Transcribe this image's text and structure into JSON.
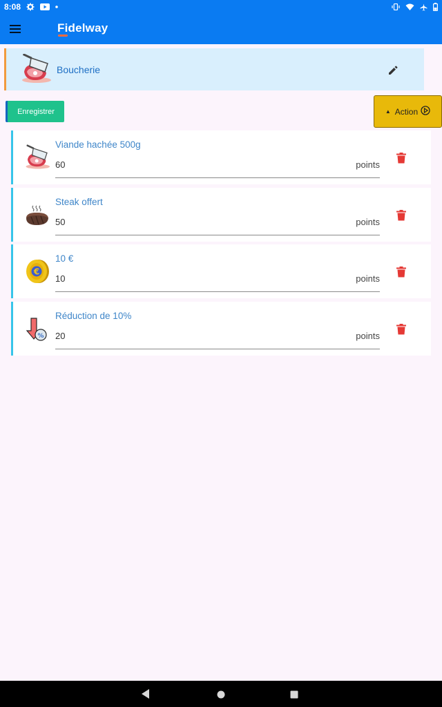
{
  "status_bar": {
    "time": "8:08",
    "left_icons": [
      "settings-icon",
      "youtube-icon",
      "dot-icon"
    ],
    "right_icons": [
      "vibrate-icon",
      "wifi-icon",
      "airplane-icon",
      "battery-icon"
    ]
  },
  "app_bar": {
    "title": "Fidelway",
    "menu_icon": "hamburger-menu-icon",
    "accent_color": "#ff6a3c"
  },
  "category": {
    "name": "Boucherie",
    "icon": "butcher-cleaver-meat-icon",
    "edit_icon": "pencil-icon"
  },
  "toolbar": {
    "save_label": "Enregistrer",
    "action_label": "Action",
    "action_icon": "play-circle-icon"
  },
  "rewards": [
    {
      "name": "Viande hachée 500g",
      "points": "60",
      "unit": "points",
      "icon": "butcher-cleaver-meat-icon"
    },
    {
      "name": "Steak offert",
      "points": "50",
      "unit": "points",
      "icon": "steak-icon"
    },
    {
      "name": "10 €",
      "points": "10",
      "unit": "points",
      "icon": "euro-coin-icon"
    },
    {
      "name": "Réduction de 10%",
      "points": "20",
      "unit": "points",
      "icon": "discount-arrow-icon"
    }
  ],
  "colors": {
    "primary": "#0a7bf2",
    "save_button": "#1fc28c",
    "action_button": "#e8b90a",
    "delete_icon": "#e53935",
    "card_accent": "#36c4ea",
    "category_bg": "#d9effd"
  }
}
